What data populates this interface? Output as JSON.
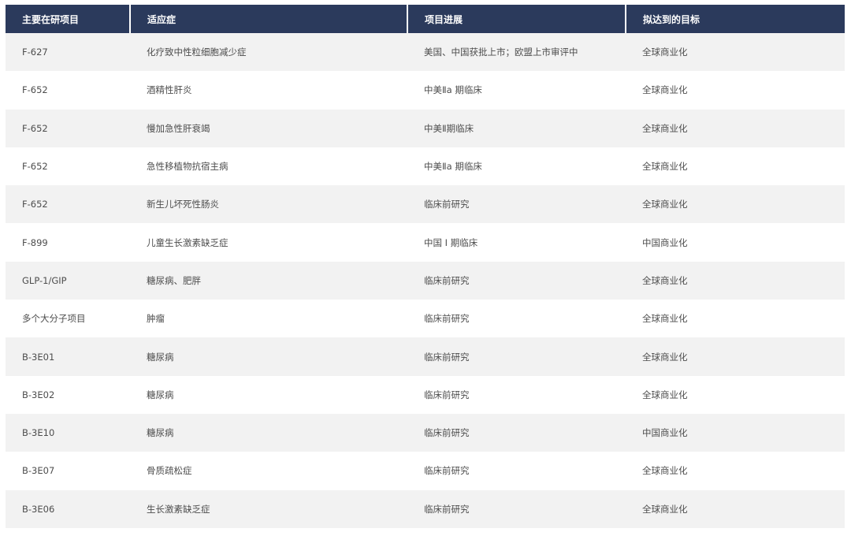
{
  "table": {
    "headers": [
      "主要在研项目",
      "适应症",
      "项目进展",
      "拟达到的目标"
    ],
    "rows": [
      [
        "F-627",
        "化疗致中性粒细胞减少症",
        "美国、中国获批上市；欧盟上市审评中",
        "全球商业化"
      ],
      [
        "F-652",
        "酒精性肝炎",
        "中美Ⅱa 期临床",
        "全球商业化"
      ],
      [
        "F-652",
        "慢加急性肝衰竭",
        "中美Ⅱ期临床",
        "全球商业化"
      ],
      [
        "F-652",
        "急性移植物抗宿主病",
        "中美Ⅱa 期临床",
        "全球商业化"
      ],
      [
        "F-652",
        "新生儿坏死性肠炎",
        "临床前研究",
        "全球商业化"
      ],
      [
        "F-899",
        "儿童生长激素缺乏症",
        "中国 I 期临床",
        "中国商业化"
      ],
      [
        "GLP-1/GIP",
        "糖尿病、肥胖",
        "临床前研究",
        "全球商业化"
      ],
      [
        "多个大分子项目",
        "肿瘤",
        "临床前研究",
        "全球商业化"
      ],
      [
        "B-3E01",
        "糖尿病",
        "临床前研究",
        "全球商业化"
      ],
      [
        "B-3E02",
        "糖尿病",
        "临床前研究",
        "全球商业化"
      ],
      [
        "B-3E10",
        "糖尿病",
        "临床前研究",
        "中国商业化"
      ],
      [
        "B-3E07",
        "骨质疏松症",
        "临床前研究",
        "全球商业化"
      ],
      [
        "B-3E06",
        "生长激素缺乏症",
        "临床前研究",
        "全球商业化"
      ]
    ]
  },
  "colors": {
    "header_bg": "#2b3a5c",
    "header_text": "#ffffff",
    "row_alt_bg": "#f2f2f2",
    "row_bg": "#ffffff"
  }
}
